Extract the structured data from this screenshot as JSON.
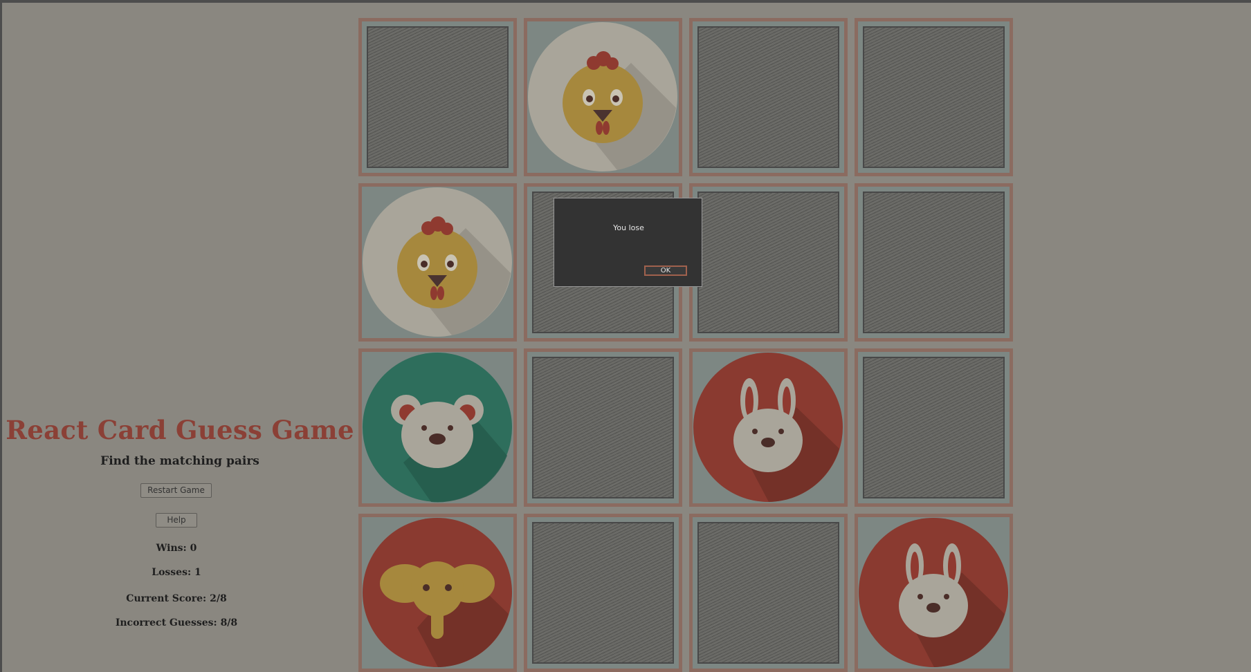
{
  "sidebar": {
    "title": "React Card Guess Game",
    "subtitle": "Find the matching pairs",
    "restart_label": "Restart Game",
    "help_label": "Help",
    "wins": "Wins: 0",
    "losses": "Losses: 1",
    "score": "Current Score: 2/8",
    "incorrect": "Incorrect Guesses: 8/8"
  },
  "board": {
    "cards": [
      {
        "face": "hidden"
      },
      {
        "face": "chicken-icon"
      },
      {
        "face": "hidden"
      },
      {
        "face": "hidden"
      },
      {
        "face": "chicken-icon"
      },
      {
        "face": "hidden"
      },
      {
        "face": "hidden"
      },
      {
        "face": "hidden"
      },
      {
        "face": "mouse-icon"
      },
      {
        "face": "hidden"
      },
      {
        "face": "rabbit-icon"
      },
      {
        "face": "hidden"
      },
      {
        "face": "elephant-icon"
      },
      {
        "face": "hidden"
      },
      {
        "face": "hidden"
      },
      {
        "face": "rabbit-icon"
      }
    ]
  },
  "dialog": {
    "message": "You lose",
    "ok_label": "OK"
  },
  "colors": {
    "title": "#8b4036",
    "card_border": "#8b6b60",
    "overlay_bg": "#8a8780",
    "dialog_bg": "#333333"
  }
}
